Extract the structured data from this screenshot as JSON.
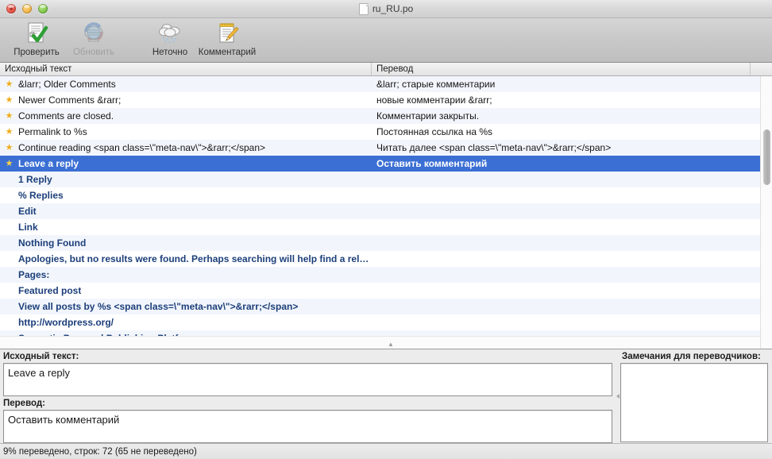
{
  "window": {
    "title": "ru_RU.po",
    "title_icon": "document-icon",
    "controls": [
      "close-button",
      "minimize-button",
      "maximize-button"
    ]
  },
  "toolbar": {
    "items": [
      {
        "label": "Проверить",
        "icon": "validate-document-check-icon",
        "disabled": false
      },
      {
        "label": "Обновить",
        "icon": "globe-refresh-icon",
        "disabled": true
      },
      {
        "label": "Неточно",
        "icon": "fuzzy-clouds-icon",
        "disabled": false
      },
      {
        "label": "Комментарий",
        "icon": "comment-notepad-pencil-icon",
        "disabled": false
      }
    ]
  },
  "list": {
    "columns": [
      {
        "label": "Исходный текст"
      },
      {
        "label": "Перевод"
      }
    ],
    "rows": [
      {
        "starred": true,
        "source": "&larr; Older Comments",
        "translation": "&larr; старые комментарии",
        "state": "translated"
      },
      {
        "starred": true,
        "source": "Newer Comments &rarr;",
        "translation": "новые комментарии &rarr;",
        "state": "translated"
      },
      {
        "starred": true,
        "source": "Comments are closed.",
        "translation": "Комментарии закрыты.",
        "state": "translated"
      },
      {
        "starred": true,
        "source": "Permalink to %s",
        "translation": "Постоянная ссылка на %s",
        "state": "translated"
      },
      {
        "starred": true,
        "source": "Continue reading <span class=\\\"meta-nav\\\">&rarr;</span>",
        "translation": "Читать далее <span class=\\\"meta-nav\\\">&rarr;</span>",
        "state": "translated"
      },
      {
        "starred": true,
        "source": "Leave a reply",
        "translation": "Оставить комментарий",
        "state": "selected"
      },
      {
        "starred": false,
        "source": "1 Reply",
        "translation": "",
        "state": "untranslated"
      },
      {
        "starred": false,
        "source": "% Replies",
        "translation": "",
        "state": "untranslated"
      },
      {
        "starred": false,
        "source": "Edit",
        "translation": "",
        "state": "untranslated"
      },
      {
        "starred": false,
        "source": "Link",
        "translation": "",
        "state": "untranslated"
      },
      {
        "starred": false,
        "source": "Nothing Found",
        "translation": "",
        "state": "untranslated"
      },
      {
        "starred": false,
        "source": "Apologies, but no results were found. Perhaps searching will help find a rela…",
        "translation": "",
        "state": "untranslated"
      },
      {
        "starred": false,
        "source": "Pages:",
        "translation": "",
        "state": "untranslated"
      },
      {
        "starred": false,
        "source": "Featured post",
        "translation": "",
        "state": "untranslated"
      },
      {
        "starred": false,
        "source": "View all posts by %s <span class=\\\"meta-nav\\\">&rarr;</span>",
        "translation": "",
        "state": "untranslated"
      },
      {
        "starred": false,
        "source": "http://wordpress.org/",
        "translation": "",
        "state": "untranslated"
      },
      {
        "starred": false,
        "source": "Semantic Personal Publishing Platform",
        "translation": "",
        "state": "untranslated"
      }
    ]
  },
  "editor": {
    "source_label": "Исходный текст:",
    "source_value": "Leave a reply",
    "target_label": "Перевод:",
    "target_value": "Оставить комментарий",
    "notes_label": "Замечания для переводчиков:",
    "notes_value": ""
  },
  "status": {
    "text": "9% переведено, строк: 72 (65 не переведено)"
  },
  "colors": {
    "selection": "#3b6fd4",
    "untranslated_text": "#1c3f7a",
    "star": "#f0ad1e",
    "alt_row": "#f2f6fc"
  }
}
